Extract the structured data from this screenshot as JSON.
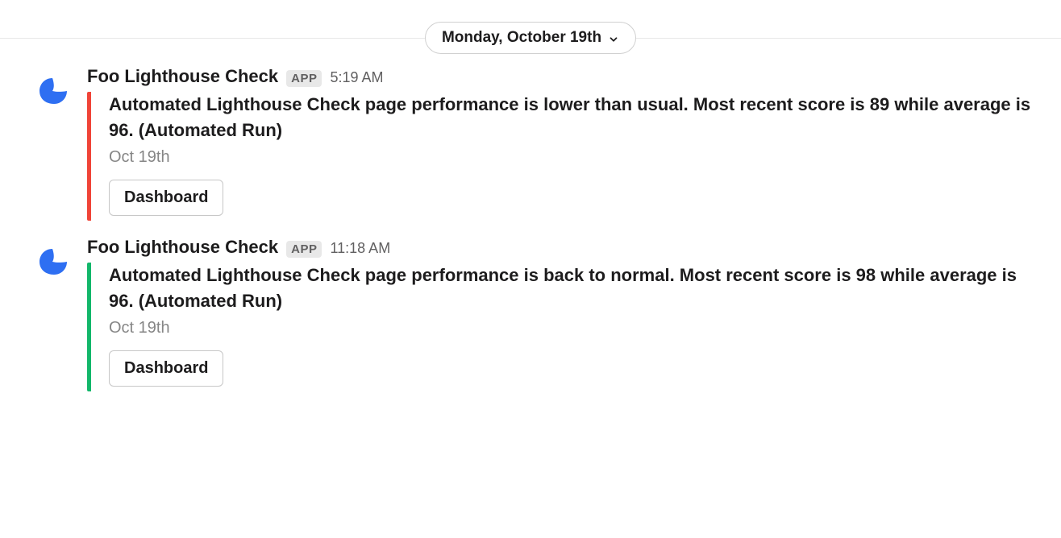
{
  "date_divider": {
    "label": "Monday, October 19th"
  },
  "colors": {
    "alert": "#f04438",
    "ok": "#12b76a",
    "avatar_blob": "#2e6ff2"
  },
  "app_badge_label": "APP",
  "messages": [
    {
      "author": "Foo Lighthouse Check",
      "time": "5:19 AM",
      "bar_color": "red",
      "body": "Automated Lighthouse Check page performance is lower than usual. Most recent score is 89 while average is 96. (Automated Run)",
      "date": "Oct 19th",
      "button": "Dashboard"
    },
    {
      "author": "Foo Lighthouse Check",
      "time": "11:18 AM",
      "bar_color": "green",
      "body": "Automated Lighthouse Check page performance is back to normal. Most recent score is 98 while average is 96. (Automated Run)",
      "date": "Oct 19th",
      "button": "Dashboard"
    }
  ]
}
